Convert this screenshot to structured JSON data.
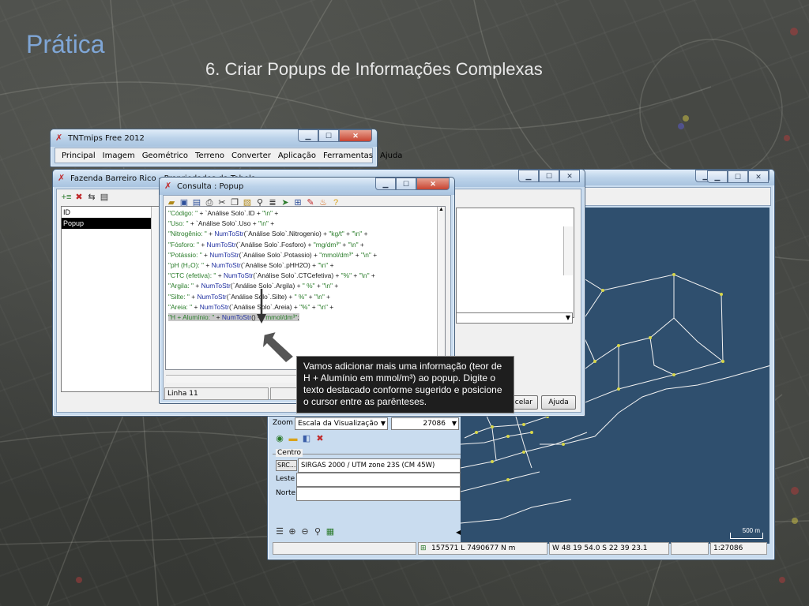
{
  "slide": {
    "title": "Prática",
    "subtitle": "6. Criar Popups de Informações Complexas"
  },
  "main_window": {
    "title": "TNTmips Free 2012",
    "menu": [
      "Principal",
      "Imagem",
      "Geométrico",
      "Terreno",
      "Converter",
      "Aplicação",
      "Ferramentas",
      "Ajuda"
    ]
  },
  "table_window": {
    "title": "Fazenda Barreiro Rico - Propriedades da Tabela",
    "list_items": [
      "ID",
      "Popup"
    ],
    "selected_item": "Popup",
    "cancel_label": "ncelar",
    "help_label": "Ajuda"
  },
  "popup_window": {
    "title": "Consulta : Popup",
    "status": "Linha 11",
    "code_lines": [
      [
        {
          "t": "\"Código: \"",
          "c": "str"
        },
        {
          "t": " + `Análise Solo`.ID + ",
          "c": "plain"
        },
        {
          "t": "\"\\n\"",
          "c": "str"
        },
        {
          "t": " +",
          "c": "plain"
        }
      ],
      [
        {
          "t": "\"Uso: \"",
          "c": "str"
        },
        {
          "t": " + `Análise Solo`.Uso + ",
          "c": "plain"
        },
        {
          "t": "\"\\n\"",
          "c": "str"
        },
        {
          "t": " +",
          "c": "plain"
        }
      ],
      [
        {
          "t": "\"Nitrogênio: \"",
          "c": "str"
        },
        {
          "t": " + ",
          "c": "plain"
        },
        {
          "t": "NumToStr",
          "c": "fn"
        },
        {
          "t": "(`Análise Solo`.Nitrogenio) + ",
          "c": "plain"
        },
        {
          "t": "\"kg/t\"",
          "c": "str"
        },
        {
          "t": " + ",
          "c": "plain"
        },
        {
          "t": "\"\\n\"",
          "c": "str"
        },
        {
          "t": " +",
          "c": "plain"
        }
      ],
      [
        {
          "t": "\"Fósforo: \"",
          "c": "str"
        },
        {
          "t": " + ",
          "c": "plain"
        },
        {
          "t": "NumToStr",
          "c": "fn"
        },
        {
          "t": "(`Análise Solo`.Fosforo) + ",
          "c": "plain"
        },
        {
          "t": "\"mg/dm³\"",
          "c": "str"
        },
        {
          "t": " + ",
          "c": "plain"
        },
        {
          "t": "\"\\n\"",
          "c": "str"
        },
        {
          "t": " +",
          "c": "plain"
        }
      ],
      [
        {
          "t": "\"Potássio: \"",
          "c": "str"
        },
        {
          "t": " + ",
          "c": "plain"
        },
        {
          "t": "NumToStr",
          "c": "fn"
        },
        {
          "t": "(`Análise Solo`.Potassio) + ",
          "c": "plain"
        },
        {
          "t": "\"mmol/dm³\"",
          "c": "str"
        },
        {
          "t": " + ",
          "c": "plain"
        },
        {
          "t": "\"\\n\"",
          "c": "str"
        },
        {
          "t": " +",
          "c": "plain"
        }
      ],
      [
        {
          "t": "\"pH (H₂O): \"",
          "c": "str"
        },
        {
          "t": " + ",
          "c": "plain"
        },
        {
          "t": "NumToStr",
          "c": "fn"
        },
        {
          "t": "(`Análise Solo`.pHH2O) + ",
          "c": "plain"
        },
        {
          "t": "\"\\n\"",
          "c": "str"
        },
        {
          "t": " +",
          "c": "plain"
        }
      ],
      [
        {
          "t": "\"CTC (efetiva): \"",
          "c": "str"
        },
        {
          "t": " + ",
          "c": "plain"
        },
        {
          "t": "NumToStr",
          "c": "fn"
        },
        {
          "t": "(`Análise Solo`.CTCefetiva) + ",
          "c": "plain"
        },
        {
          "t": "\"%\"",
          "c": "str"
        },
        {
          "t": " + ",
          "c": "plain"
        },
        {
          "t": "\"\\n\"",
          "c": "str"
        },
        {
          "t": " +",
          "c": "plain"
        }
      ],
      [
        {
          "t": "\"Argila: \"",
          "c": "str"
        },
        {
          "t": " + ",
          "c": "plain"
        },
        {
          "t": "NumToStr",
          "c": "fn"
        },
        {
          "t": "(`Análise Solo`.Argila) + ",
          "c": "plain"
        },
        {
          "t": "\" %\"",
          "c": "str"
        },
        {
          "t": " + ",
          "c": "plain"
        },
        {
          "t": "\"\\n\"",
          "c": "str"
        },
        {
          "t": " +",
          "c": "plain"
        }
      ],
      [
        {
          "t": "\"Silte: \"",
          "c": "str"
        },
        {
          "t": " + ",
          "c": "plain"
        },
        {
          "t": "NumToStr",
          "c": "fn"
        },
        {
          "t": "(`Análise Solo`.Silte) + ",
          "c": "plain"
        },
        {
          "t": "\" %\"",
          "c": "str"
        },
        {
          "t": " + ",
          "c": "plain"
        },
        {
          "t": "\"\\n\"",
          "c": "str"
        },
        {
          "t": " +",
          "c": "plain"
        }
      ],
      [
        {
          "t": "\"Areia: \"",
          "c": "str"
        },
        {
          "t": " + ",
          "c": "plain"
        },
        {
          "t": "NumToStr",
          "c": "fn"
        },
        {
          "t": "(`Análise Solo`.Areia) + ",
          "c": "plain"
        },
        {
          "t": "\"%\"",
          "c": "str"
        },
        {
          "t": " + ",
          "c": "plain"
        },
        {
          "t": "\"\\n\"",
          "c": "str"
        },
        {
          "t": " +",
          "c": "plain"
        }
      ],
      [
        {
          "t": "\"H + Alumínio: \"",
          "c": "str hl"
        },
        {
          "t": " + ",
          "c": "plain hl"
        },
        {
          "t": "NumToStr",
          "c": "fn hl"
        },
        {
          "t": "() + ",
          "c": "plain hl"
        },
        {
          "t": "\"mmol/dm³\"",
          "c": "str hl"
        },
        {
          "t": ";",
          "c": "plain hl"
        }
      ]
    ]
  },
  "map_window": {
    "zoom_label": "Zoom",
    "zoom_mode": "Escala da Visualização",
    "zoom_value": "27086",
    "center_group": "Centro",
    "src_label": "SRC...",
    "src_value": "SIRGAS 2000 / UTM zone 23S (CM 45W)",
    "east_label": "Leste",
    "north_label": "Norte",
    "coord_status": "157571 L 7490677 N m",
    "latlon_status": "W 48 19 54.0  S 22 39 23.1",
    "scale_status": "1:27086",
    "scalebar_label": "500 m"
  },
  "callout": {
    "text": "Vamos adicionar mais uma informação (teor de H + Alumínio em mmol/m³) ao popup. Digite o texto destacado conforme sugerido e posicione o cursor entre as parênteses."
  },
  "colors": {
    "title": "#7fa6d6",
    "map_bg": "#2f4f6e",
    "map_lines": "#f2f2f2",
    "code_string": "#2a7d2a",
    "code_function": "#1f2fa0"
  }
}
